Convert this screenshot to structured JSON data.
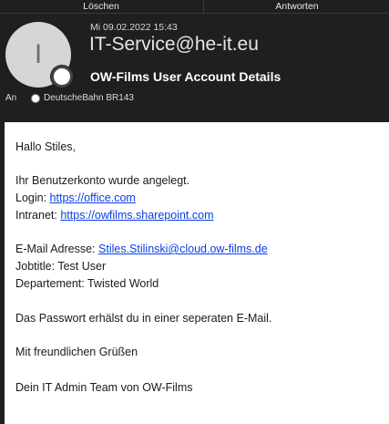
{
  "toolbar": {
    "delete_label": "Löschen",
    "reply_label": "Antworten"
  },
  "header": {
    "avatar_initial": "I",
    "date": "Mi 09.02.2022 15:43",
    "sender": "IT-Service@he-it.eu",
    "subject": "OW-Films User Account Details",
    "to_label": "An",
    "recipient": "DeutscheBahn BR143"
  },
  "body": {
    "greeting": "Hallo Stiles,",
    "account_created": "Ihr Benutzerkonto wurde angelegt.",
    "login_label": "Login:",
    "login_link": "https://office.com",
    "intranet_label": "Intranet:",
    "intranet_link": "https://owfilms.sharepoint.com",
    "email_label": "E-Mail Adresse:",
    "email_link": "Stiles.Stilinski@cloud.ow-films.de",
    "jobtitle": "Jobtitle: Test User",
    "department": "Departement: Twisted World",
    "password_note": "Das Passwort erhälst du in einer seperaten E-Mail.",
    "closing": "Mit freundlichen Grüßen",
    "signature": "Dein IT Admin Team von OW-Films"
  }
}
